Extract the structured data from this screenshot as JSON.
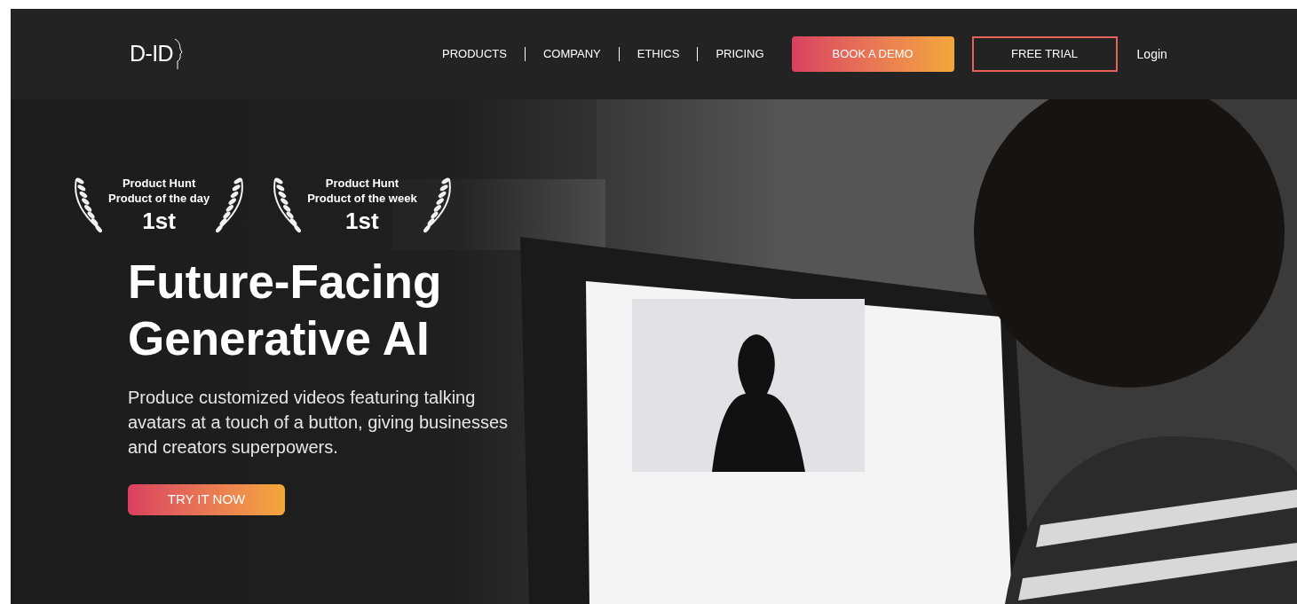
{
  "header": {
    "logo": "D-ID",
    "nav": [
      {
        "label": "PRODUCTS"
      },
      {
        "label": "COMPANY"
      },
      {
        "label": "ETHICS"
      },
      {
        "label": "PRICING"
      }
    ],
    "buttons": [
      {
        "label": "BOOK A DEMO",
        "kind": "filled"
      },
      {
        "label": "FREE TRIAL",
        "kind": "outline"
      },
      {
        "label": "Login",
        "kind": "link"
      }
    ]
  },
  "hero": {
    "background": {
      "kind": "picture"
    },
    "awards": [
      {
        "source": "Product Hunt",
        "title": "Product of the day",
        "rank": "1st"
      },
      {
        "source": "Product Hunt",
        "title": "Product of the week",
        "rank": "1st"
      }
    ],
    "headline": [
      "Future-Facing",
      "Generative AI"
    ],
    "description": "Produce customized videos featuring talking avatars at a touch of a button, giving businesses and creators superpowers.",
    "cta": "TRY IT NOW"
  }
}
